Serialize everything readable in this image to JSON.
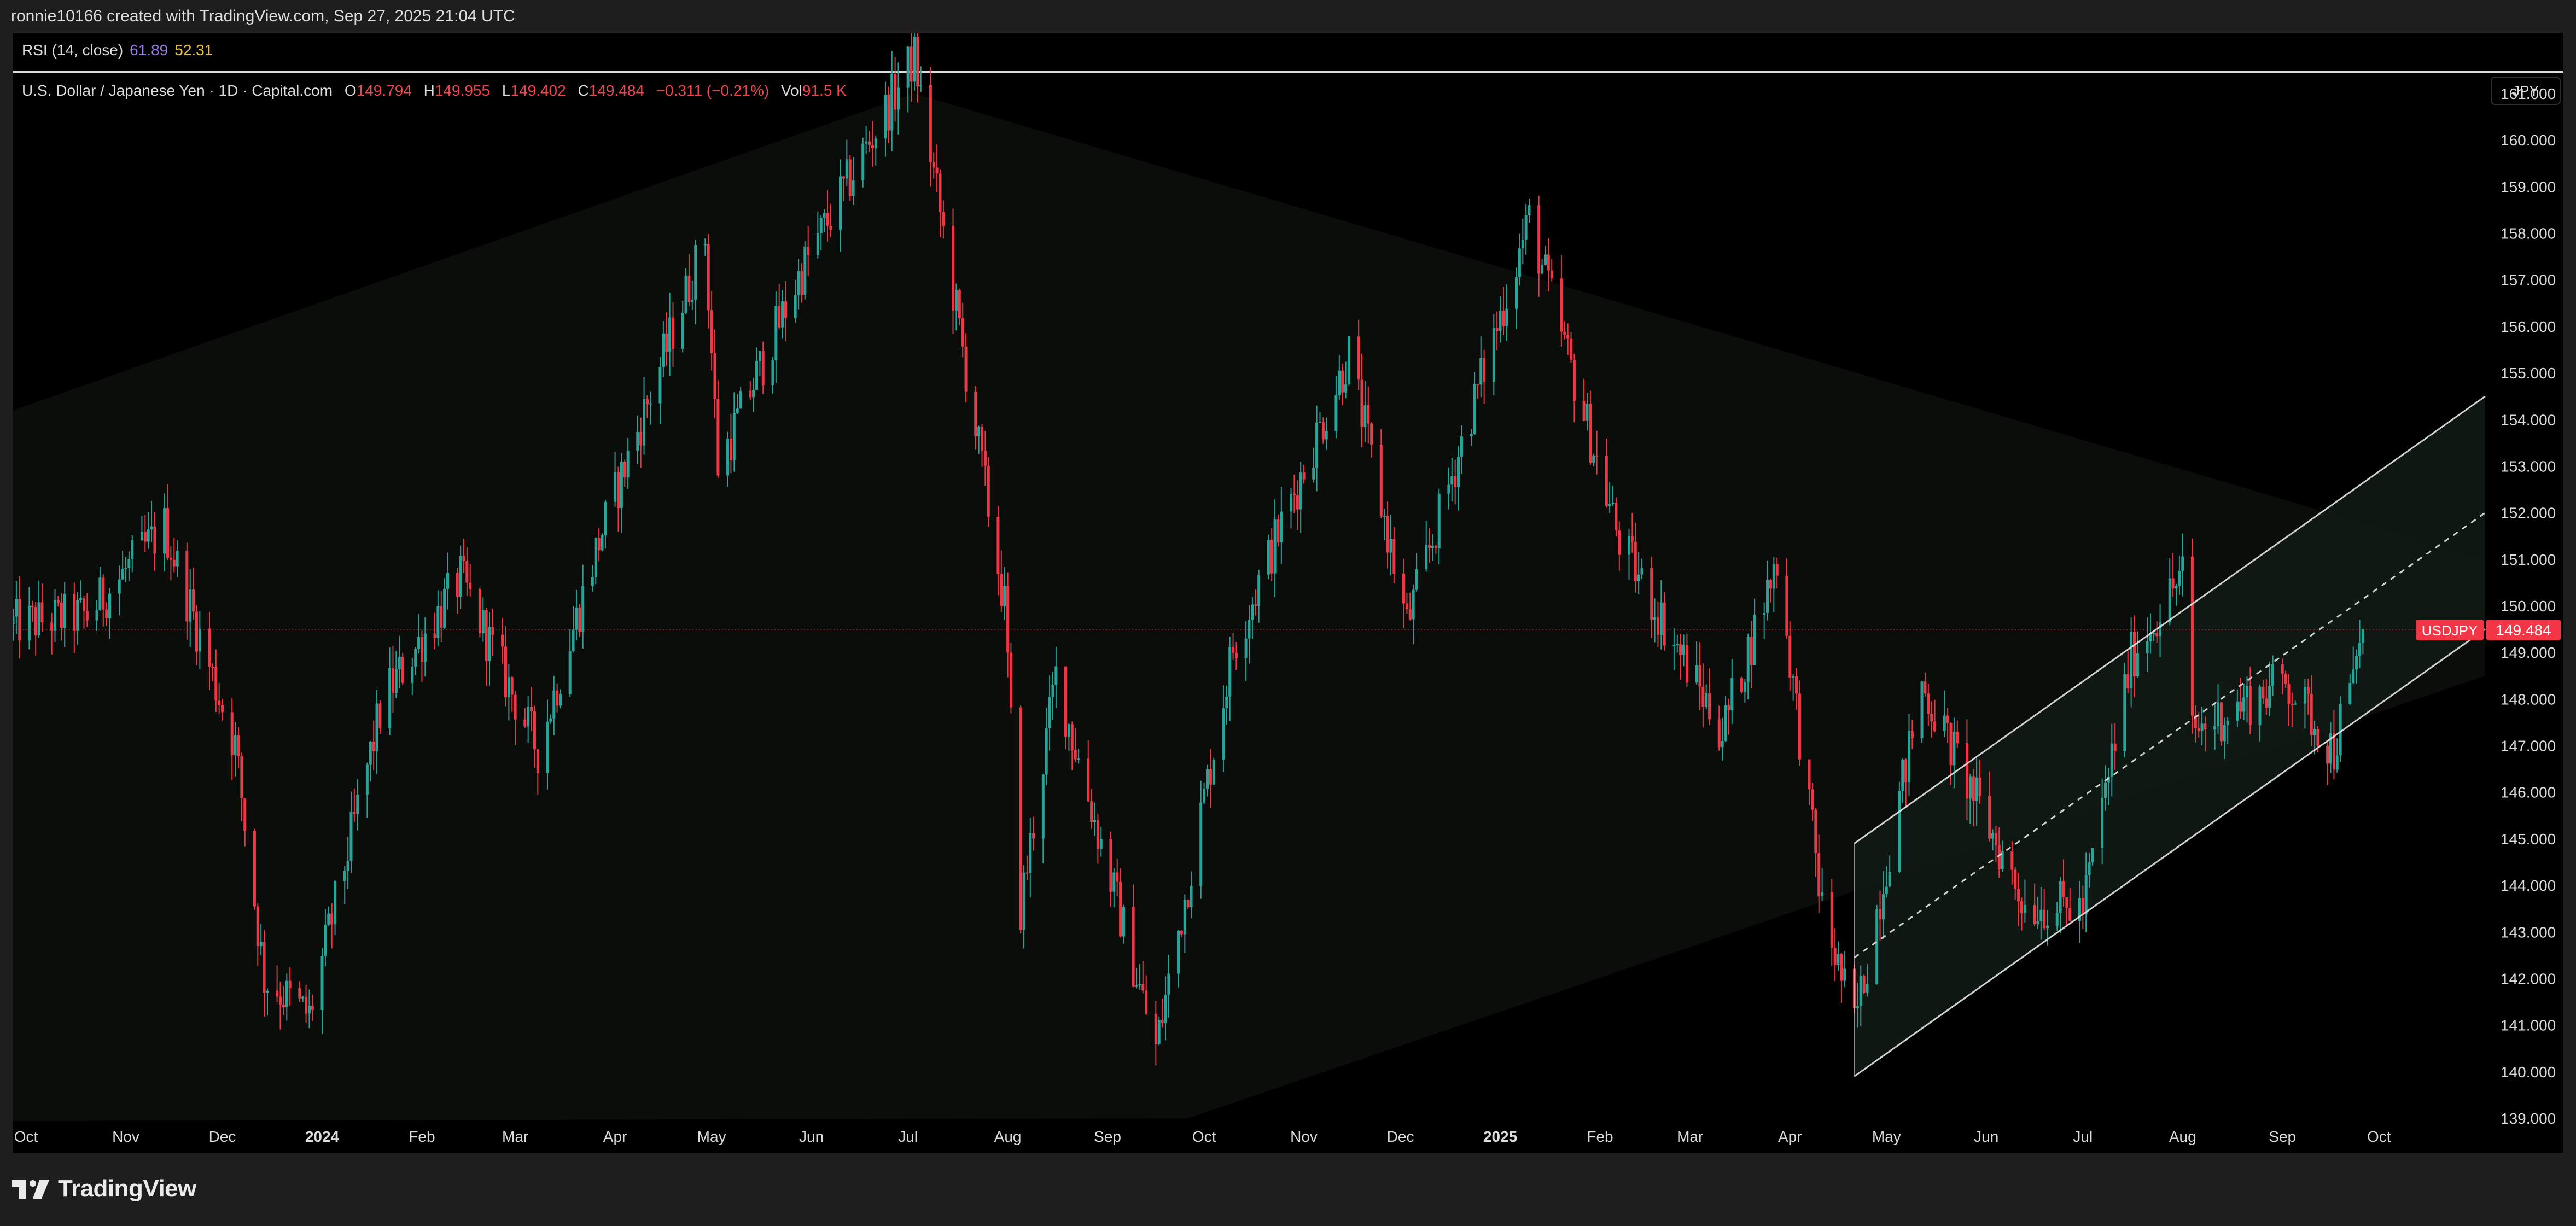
{
  "header": {
    "credit": "ronnie10166 created with TradingView.com, Sep 27, 2025 21:04 UTC"
  },
  "rsi": {
    "label": "RSI (14, close)",
    "value1": "61.89",
    "value2": "52.31"
  },
  "legend": {
    "symbol_title": "U.S. Dollar / Japanese Yen · 1D · Capital.com",
    "open_key": "O",
    "open": "149.794",
    "high_key": "H",
    "high": "149.955",
    "low_key": "L",
    "low": "149.402",
    "close_key": "C",
    "close": "149.484",
    "change": "−0.311 (−0.21%)",
    "vol_key": "Vol",
    "vol": "91.5 K"
  },
  "currency_button": "JPY",
  "price_tag": {
    "symbol": "USDJPY",
    "price": "149.484"
  },
  "footer": {
    "brand": "TradingView"
  },
  "colors": {
    "up": "#26a69a",
    "down": "#f23645",
    "background": "#000000",
    "channel": "#e6e6e6",
    "tag": "#f23645"
  },
  "chart_data": {
    "type": "candlestick",
    "symbol": "USDJPY",
    "ylim": [
      139.0,
      161.0
    ],
    "y_ticks": [
      "139.000",
      "140.000",
      "141.000",
      "142.000",
      "143.000",
      "144.000",
      "145.000",
      "146.000",
      "147.000",
      "148.000",
      "149.000",
      "150.000",
      "151.000",
      "152.000",
      "153.000",
      "154.000",
      "155.000",
      "156.000",
      "157.000",
      "158.000",
      "159.000",
      "160.000",
      "161.000"
    ],
    "x_ticks": [
      {
        "label": "Oct",
        "date": "2023-10-01"
      },
      {
        "label": "Nov",
        "date": "2023-11-01"
      },
      {
        "label": "Dec",
        "date": "2023-12-01"
      },
      {
        "label": "2024",
        "date": "2024-01-01",
        "bold": true
      },
      {
        "label": "Feb",
        "date": "2024-02-01"
      },
      {
        "label": "Mar",
        "date": "2024-03-01"
      },
      {
        "label": "Apr",
        "date": "2024-04-01"
      },
      {
        "label": "May",
        "date": "2024-05-01"
      },
      {
        "label": "Jun",
        "date": "2024-06-01"
      },
      {
        "label": "Jul",
        "date": "2024-07-01"
      },
      {
        "label": "Aug",
        "date": "2024-08-01"
      },
      {
        "label": "Sep",
        "date": "2024-09-01"
      },
      {
        "label": "Oct",
        "date": "2024-10-01"
      },
      {
        "label": "Nov",
        "date": "2024-11-01"
      },
      {
        "label": "Dec",
        "date": "2024-12-01"
      },
      {
        "label": "2025",
        "date": "2025-01-01",
        "bold": true
      },
      {
        "label": "Feb",
        "date": "2025-02-01"
      },
      {
        "label": "Mar",
        "date": "2025-03-01"
      },
      {
        "label": "Apr",
        "date": "2025-04-01"
      },
      {
        "label": "May",
        "date": "2025-05-01"
      },
      {
        "label": "Jun",
        "date": "2025-06-01"
      },
      {
        "label": "Jul",
        "date": "2025-07-01"
      },
      {
        "label": "Aug",
        "date": "2025-08-01"
      },
      {
        "label": "Sep",
        "date": "2025-09-01"
      },
      {
        "label": "Oct",
        "date": "2025-10-01"
      }
    ],
    "close_path": [
      {
        "date": "2023-09-27",
        "close": 149.6
      },
      {
        "date": "2023-10-20",
        "close": 149.8
      },
      {
        "date": "2023-11-13",
        "close": 151.7
      },
      {
        "date": "2023-12-05",
        "close": 147.0
      },
      {
        "date": "2023-12-14",
        "close": 142.0
      },
      {
        "date": "2023-12-28",
        "close": 141.2
      },
      {
        "date": "2024-01-20",
        "close": 148.0
      },
      {
        "date": "2024-02-13",
        "close": 150.6
      },
      {
        "date": "2024-03-08",
        "close": 146.9
      },
      {
        "date": "2024-03-27",
        "close": 151.4
      },
      {
        "date": "2024-04-29",
        "close": 157.9
      },
      {
        "date": "2024-05-03",
        "close": 153.0
      },
      {
        "date": "2024-05-29",
        "close": 157.2
      },
      {
        "date": "2024-07-03",
        "close": 161.8
      },
      {
        "date": "2024-07-31",
        "close": 150.0
      },
      {
        "date": "2024-08-05",
        "close": 143.5
      },
      {
        "date": "2024-08-16",
        "close": 148.5
      },
      {
        "date": "2024-09-16",
        "close": 140.5
      },
      {
        "date": "2024-10-10",
        "close": 149.1
      },
      {
        "date": "2024-11-15",
        "close": 155.4
      },
      {
        "date": "2024-12-03",
        "close": 149.6
      },
      {
        "date": "2025-01-10",
        "close": 158.3
      },
      {
        "date": "2025-02-07",
        "close": 151.4
      },
      {
        "date": "2025-03-11",
        "close": 147.3
      },
      {
        "date": "2025-03-28",
        "close": 151.0
      },
      {
        "date": "2025-04-11",
        "close": 143.5
      },
      {
        "date": "2025-04-21",
        "close": 141.0
      },
      {
        "date": "2025-05-12",
        "close": 148.3
      },
      {
        "date": "2025-06-13",
        "close": 143.6
      },
      {
        "date": "2025-07-01",
        "close": 143.5
      },
      {
        "date": "2025-07-16",
        "close": 148.9
      },
      {
        "date": "2025-08-01",
        "close": 150.7
      },
      {
        "date": "2025-08-04",
        "close": 147.3
      },
      {
        "date": "2025-09-02",
        "close": 148.4
      },
      {
        "date": "2025-09-17",
        "close": 146.9
      },
      {
        "date": "2025-09-26",
        "close": 149.5
      }
    ],
    "last_close": 149.484,
    "channel": {
      "upper": [
        {
          "date": "2025-04-21",
          "price": 144.9
        },
        {
          "date": "2025-11-03",
          "price": 154.5
        }
      ],
      "middle": [
        {
          "date": "2025-04-21",
          "price": 142.45
        },
        {
          "date": "2025-11-03",
          "price": 152.0
        }
      ],
      "lower": [
        {
          "date": "2025-04-21",
          "price": 139.9
        },
        {
          "date": "2025-11-03",
          "price": 149.5
        }
      ]
    },
    "broad_channel": {
      "upper": [
        {
          "date": "2023-09-27",
          "price": 154.2
        },
        {
          "date": "2024-07-03",
          "price": 161.0
        },
        {
          "date": "2025-11-03",
          "price": 151.0
        }
      ],
      "lower": [
        {
          "date": "2024-09-26",
          "price": 139.0
        },
        {
          "date": "2025-11-03",
          "price": 148.5
        }
      ]
    }
  }
}
